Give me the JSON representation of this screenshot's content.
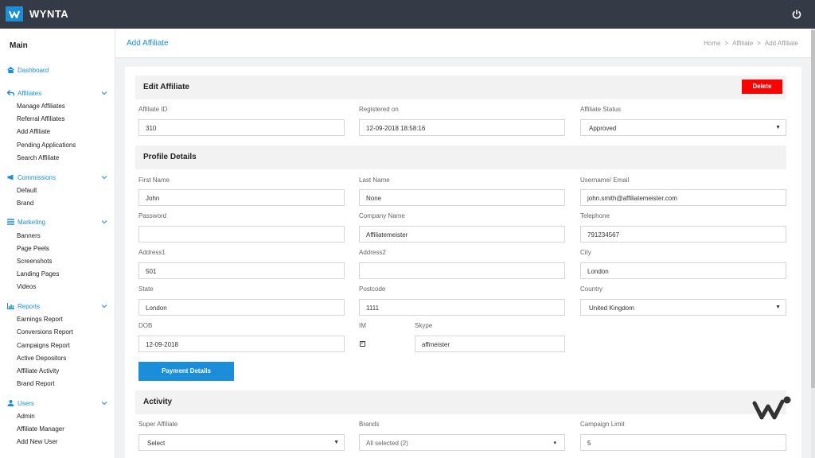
{
  "app": {
    "brand": "WYNTA"
  },
  "sidebar": {
    "title": "Main",
    "dashboard": "Dashboard",
    "sections": [
      {
        "label": "Affiliates",
        "items": [
          "Manage Affiliates",
          "Referral Affiliates",
          "Add Affiliate",
          "Pending Applications",
          "Search Affiliate"
        ]
      },
      {
        "label": "Commissions",
        "items": [
          "Default",
          "Brand"
        ]
      },
      {
        "label": "Marketing",
        "items": [
          "Banners",
          "Page Peels",
          "Screenshots",
          "Landing Pages",
          "Videos"
        ]
      },
      {
        "label": "Reports",
        "items": [
          "Earnings Report",
          "Conversions Report",
          "Campaigns Report",
          "Active Depositors",
          "Affiliate Activity",
          "Brand Report"
        ]
      },
      {
        "label": "Users",
        "items": [
          "Admin",
          "Affiliate Manager",
          "Add New User"
        ]
      }
    ]
  },
  "header": {
    "title": "Add Affiliate",
    "breadcrumb": [
      "Home",
      ">",
      "Affiliate",
      ">",
      "Add Affiliate"
    ]
  },
  "edit": {
    "title": "Edit Affiliate",
    "delete_label": "Delete",
    "affiliate_id_label": "Affiliate ID",
    "affiliate_id": "310",
    "registered_label": "Registered on",
    "registered": "12-09-2018 18:58:16",
    "status_label": "Affiliate Status",
    "status": "Approved"
  },
  "profile": {
    "title": "Profile Details",
    "first_name_label": "First Name",
    "first_name": "John",
    "last_name_label": "Last Name",
    "last_name": "None",
    "email_label": "Username/ Email",
    "email": "john.smith@affiliatemeister.com",
    "password_label": "Password",
    "password": "",
    "company_label": "Company Name",
    "company": "Affiliatemeister",
    "telephone_label": "Telephone",
    "telephone": "791234567",
    "address1_label": "Address1",
    "address1": "501",
    "address2_label": "Address2",
    "address2": "",
    "city_label": "City",
    "city": "London",
    "state_label": "State",
    "state": "London",
    "postcode_label": "Postcode",
    "postcode": "1111",
    "country_label": "Country",
    "country": "United Kingdom",
    "dob_label": "DOB",
    "dob": "12-09-2018",
    "im_label": "IM",
    "im_checked": true,
    "skype_label": "Skype",
    "skype": "affmeister",
    "payment_label": "Payment Details"
  },
  "activity": {
    "title": "Activity",
    "super_label": "Super Affiliate",
    "super_value": "Select",
    "brands_label": "Brands",
    "brands_value": "All selected (2)",
    "limit_label": "Campaign Limit",
    "limit_value": "5"
  },
  "colors": {
    "accent": "#1a8ed8",
    "topbar": "#353b46",
    "danger": "#ff0000"
  }
}
